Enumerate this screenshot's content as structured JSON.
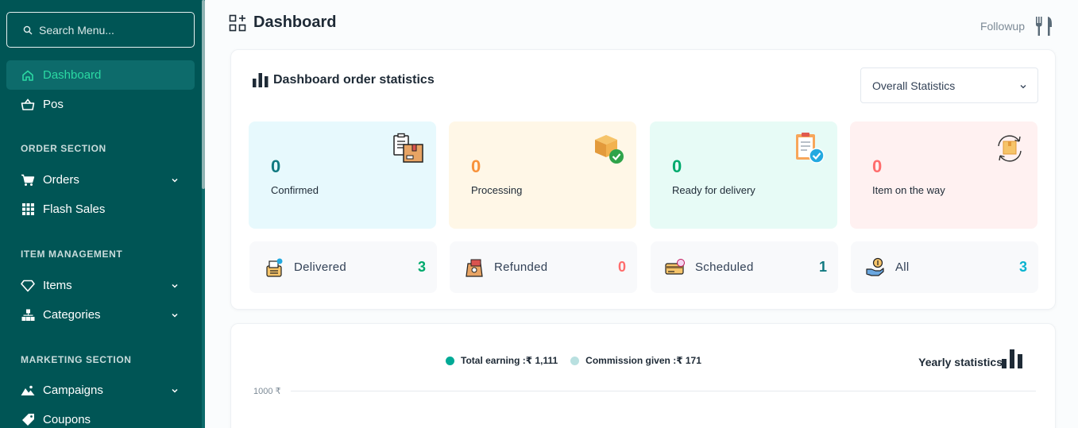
{
  "sidebar": {
    "search_placeholder": "Search Menu...",
    "dashboard": "Dashboard",
    "pos": "Pos",
    "order_section": "ORDER SECTION",
    "orders": "Orders",
    "flash_sales": "Flash Sales",
    "item_management": "ITEM MANAGEMENT",
    "items": "Items",
    "categories": "Categories",
    "marketing_section": "MARKETING SECTION",
    "campaigns": "Campaigns",
    "coupons": "Coupons"
  },
  "header": {
    "title": "Dashboard",
    "followup": "Followup"
  },
  "stats": {
    "title": "Dashboard order statistics",
    "filter_value": "Overall Statistics",
    "tiles": [
      {
        "value": "0",
        "label": "Confirmed",
        "color": "#107980",
        "bg": "#e7f9fd"
      },
      {
        "value": "0",
        "label": "Processing",
        "color": "#f8923b",
        "bg": "#fff7e7"
      },
      {
        "value": "0",
        "label": "Ready for delivery",
        "color": "#00aa6d",
        "bg": "#e7fbf6"
      },
      {
        "value": "0",
        "label": "Item on the way",
        "color": "#ff6d6d",
        "bg": "#fff1f1"
      }
    ],
    "minis": [
      {
        "label": "Delivered",
        "value": "3",
        "color": "#00aa6d"
      },
      {
        "label": "Refunded",
        "value": "0",
        "color": "#ff6d6d"
      },
      {
        "label": "Scheduled",
        "value": "1",
        "color": "#107980"
      },
      {
        "label": "All",
        "value": "3",
        "color": "#0ab3d0"
      }
    ]
  },
  "chart": {
    "legend_earning": "Total earning :₹ 1,111",
    "legend_commission": "Commission given :₹ 171",
    "title": "Yearly statistics",
    "ytick": "1000 ₹"
  },
  "chart_data": {
    "type": "bar",
    "title": "Yearly statistics",
    "series": [
      {
        "name": "Total earning",
        "total": 1111
      },
      {
        "name": "Commission given",
        "total": 171
      }
    ],
    "yticks": [
      "1000 ₹"
    ]
  },
  "colors": {
    "sidebar_bg": "#005555",
    "accent": "#2bd9a3",
    "earning_dot": "#00aa96",
    "commission_dot": "#b9e0e0"
  }
}
